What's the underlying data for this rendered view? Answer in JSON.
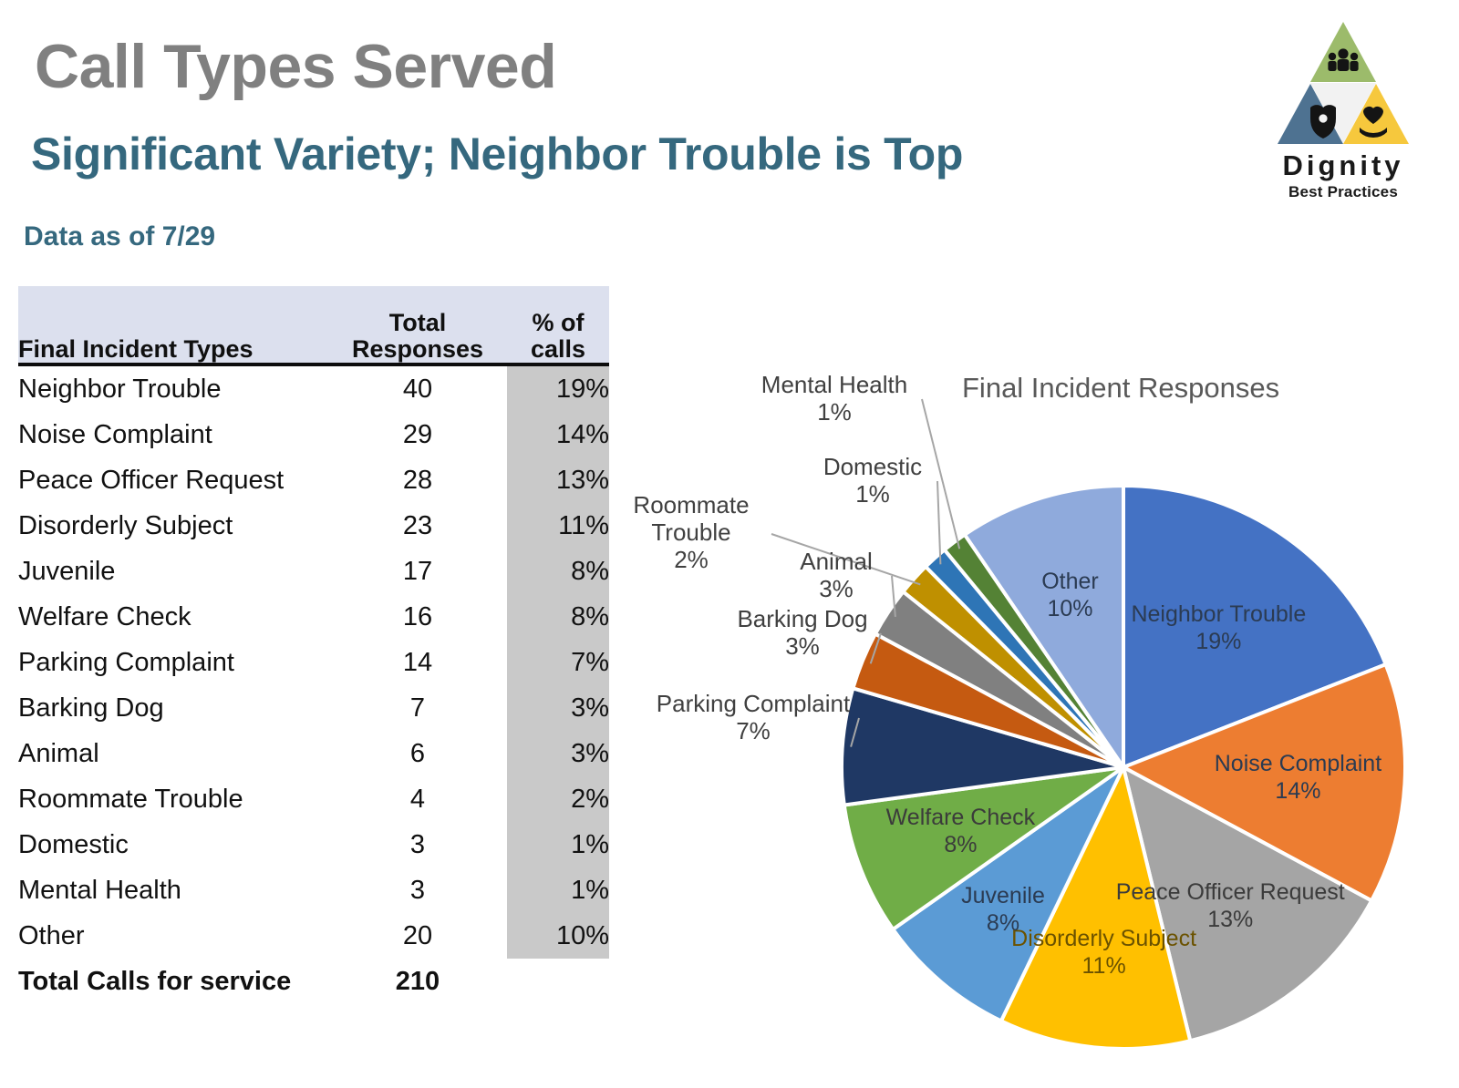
{
  "header": {
    "title": "Call Types Served",
    "subtitle": "Significant Variety; Neighbor Trouble is Top",
    "data_asof": "Data as of 7/29"
  },
  "logo": {
    "word": "Dignity",
    "tagline": "Best Practices",
    "icons": [
      "people-icon",
      "police-badge-icon",
      "heart-in-hands-icon"
    ],
    "colors": {
      "green": "#9CBB6B",
      "blue": "#4E7291",
      "yellow": "#F6C83D"
    }
  },
  "table": {
    "columns": [
      "Final Incident Types",
      "Total Responses",
      "% of calls"
    ],
    "header_bg": "#DCE0EE",
    "pct_column_bg": "#C9C9C9",
    "rows": [
      {
        "type": "Neighbor Trouble",
        "responses": "40",
        "pct": "19%"
      },
      {
        "type": "Noise Complaint",
        "responses": "29",
        "pct": "14%"
      },
      {
        "type": "Peace Officer Request",
        "responses": "28",
        "pct": "13%"
      },
      {
        "type": "Disorderly Subject",
        "responses": "23",
        "pct": "11%"
      },
      {
        "type": "Juvenile",
        "responses": "17",
        "pct": "8%"
      },
      {
        "type": "Welfare Check",
        "responses": "16",
        "pct": "8%"
      },
      {
        "type": "Parking Complaint",
        "responses": "14",
        "pct": "7%"
      },
      {
        "type": "Barking Dog",
        "responses": "7",
        "pct": "3%"
      },
      {
        "type": "Animal",
        "responses": "6",
        "pct": "3%"
      },
      {
        "type": "Roommate Trouble",
        "responses": "4",
        "pct": "2%"
      },
      {
        "type": "Domestic",
        "responses": "3",
        "pct": "1%"
      },
      {
        "type": "Mental Health",
        "responses": "3",
        "pct": "1%"
      },
      {
        "type": "Other",
        "responses": "20",
        "pct": "10%"
      }
    ],
    "total": {
      "type": "Total Calls for service",
      "responses": "210",
      "pct": ""
    }
  },
  "chart_data": {
    "type": "pie",
    "title": "Final Incident Responses",
    "total_label": "Total Calls for service",
    "total_value": 210,
    "start_angle_deg": 0,
    "direction": "clockwise",
    "categories": [
      "Neighbor Trouble",
      "Noise Complaint",
      "Peace Officer Request",
      "Disorderly Subject",
      "Juvenile",
      "Welfare Check",
      "Parking Complaint",
      "Barking Dog",
      "Animal",
      "Roommate Trouble",
      "Domestic",
      "Mental Health",
      "Other"
    ],
    "values": [
      40,
      29,
      28,
      23,
      17,
      16,
      14,
      7,
      6,
      4,
      3,
      3,
      20
    ],
    "percents": [
      "19%",
      "14%",
      "13%",
      "11%",
      "8%",
      "8%",
      "7%",
      "3%",
      "3%",
      "2%",
      "1%",
      "1%",
      "10%"
    ],
    "colors": [
      "#4472C4",
      "#ED7D31",
      "#A5A5A5",
      "#FFC000",
      "#5B9BD5",
      "#70AD47",
      "#1F3864",
      "#C55A11",
      "#808080",
      "#BF9000",
      "#2E75B6",
      "#548235",
      "#8FAADC"
    ],
    "labels": [
      {
        "name": "Neighbor Trouble",
        "pct": "19%",
        "placement": "inside"
      },
      {
        "name": "Noise Complaint",
        "pct": "14%",
        "placement": "inside"
      },
      {
        "name": "Peace Officer Request",
        "pct": "13%",
        "placement": "inside"
      },
      {
        "name": "Disorderly Subject",
        "pct": "11%",
        "placement": "inside"
      },
      {
        "name": "Juvenile",
        "pct": "8%",
        "placement": "inside"
      },
      {
        "name": "Welfare Check",
        "pct": "8%",
        "placement": "inside"
      },
      {
        "name": "Parking Complaint",
        "pct": "7%",
        "placement": "outside"
      },
      {
        "name": "Barking Dog",
        "pct": "3%",
        "placement": "outside"
      },
      {
        "name": "Animal",
        "pct": "3%",
        "placement": "outside"
      },
      {
        "name": "Roommate Trouble",
        "pct": "2%",
        "placement": "outside"
      },
      {
        "name": "Domestic",
        "pct": "1%",
        "placement": "outside"
      },
      {
        "name": "Mental Health",
        "pct": "1%",
        "placement": "outside"
      },
      {
        "name": "Other",
        "pct": "10%",
        "placement": "inside"
      }
    ],
    "legend": "none",
    "grid": false
  }
}
